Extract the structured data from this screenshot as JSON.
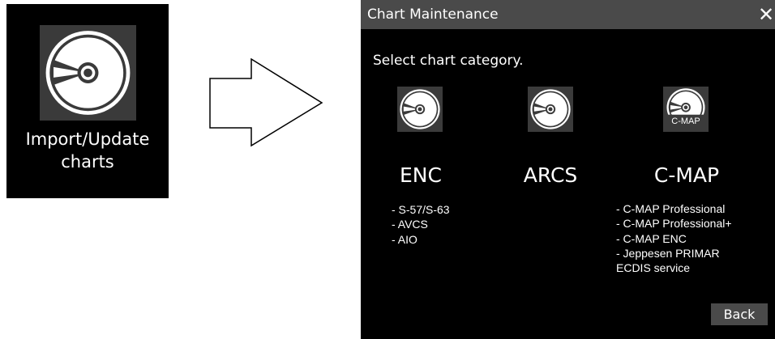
{
  "tile": {
    "icon": "disc-icon",
    "label_lines": [
      "Import/Update",
      "charts"
    ]
  },
  "arrow": {
    "icon": "right-arrow-icon"
  },
  "dialog": {
    "title": "Chart Maintenance",
    "close_icon": "close-icon",
    "close_label": "✕",
    "prompt": "Select chart category.",
    "categories": [
      {
        "name": "ENC",
        "icon": "disc-icon",
        "items": [
          "- S-57/S-63",
          "- AVCS",
          "- AIO"
        ]
      },
      {
        "name": "ARCS",
        "icon": "disc-icon",
        "items": []
      },
      {
        "name": "C-MAP",
        "icon": "disc-icon",
        "badge": "C-MAP",
        "items": [
          "- C-MAP Professional",
          "- C-MAP Professional+",
          "- C-MAP ENC",
          "- Jeppesen PRIMAR",
          "ECDIS service"
        ]
      }
    ],
    "back_label": "Back"
  },
  "colors": {
    "background": "#000000",
    "titlebar": "#4a4a4a",
    "icon_bg": "#3b3b3b",
    "text": "#ffffff"
  }
}
